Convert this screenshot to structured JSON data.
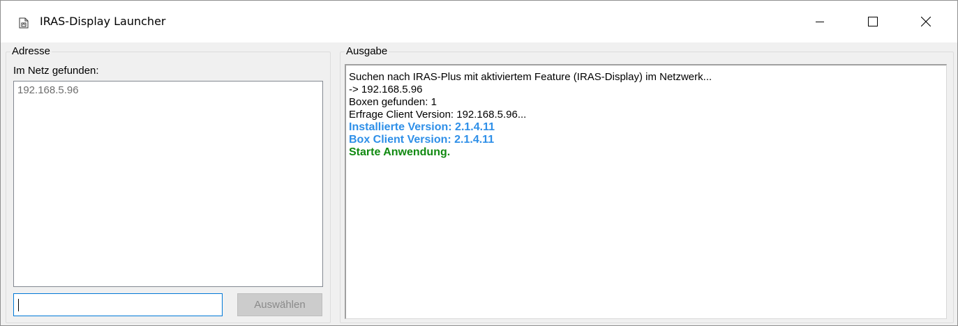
{
  "window": {
    "title": "IRAS-Display Launcher",
    "icon": "document-app-icon",
    "controls": [
      "minimize-icon",
      "maximize-icon",
      "close-icon"
    ]
  },
  "address_group": {
    "legend": "Adresse",
    "found_label": "Im Netz gefunden:",
    "list_items": [
      "192.168.5.96"
    ],
    "input_value": "",
    "select_button": "Auswählen"
  },
  "output_group": {
    "legend": "Ausgabe",
    "lines": [
      {
        "text": "Suchen nach IRAS-Plus mit aktiviertem Feature (IRAS-Display) im Netzwerk...",
        "style": "normal"
      },
      {
        "text": "-> 192.168.5.96",
        "style": "normal"
      },
      {
        "text": "Boxen gefunden: 1",
        "style": "normal"
      },
      {
        "text": "Erfrage Client Version: 192.168.5.96...",
        "style": "normal"
      },
      {
        "text": "Installierte Version: 2.1.4.11",
        "style": "info"
      },
      {
        "text": "Box Client Version: 2.1.4.11",
        "style": "info"
      },
      {
        "text": "Starte Anwendung.",
        "style": "ok"
      }
    ]
  },
  "colors": {
    "info_text": "#2e8fe8",
    "success_text": "#118a11",
    "input_focus_border": "#0078d7"
  }
}
